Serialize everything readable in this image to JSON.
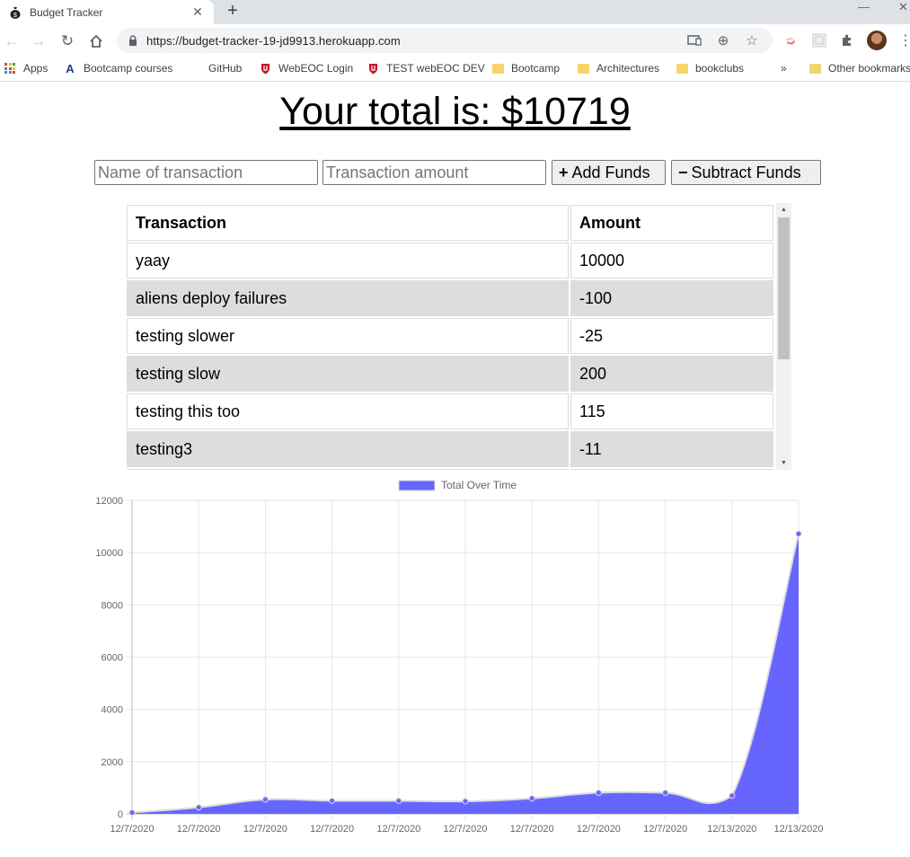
{
  "browser": {
    "tab_title": "Budget Tracker",
    "url": "https://budget-tracker-19-jd9913.herokuapp.com",
    "new_tab_symbol": "+",
    "bookmarks": [
      "Apps",
      "Bootcamp courses",
      "GitHub",
      "WebEOC Login",
      "TEST webEOC DEV",
      "Bootcamp",
      "Architectures",
      "bookclubs"
    ],
    "overflow_symbol": "»",
    "other_bookmarks": "Other bookmarks"
  },
  "page": {
    "title": "Your total is: $10719",
    "name_placeholder": "Name of transaction",
    "amount_placeholder": "Transaction amount",
    "add_label": "Add Funds",
    "subtract_label": "Subtract Funds",
    "add_icon": "+",
    "subtract_icon": "−"
  },
  "table": {
    "headers": [
      "Transaction",
      "Amount"
    ],
    "rows": [
      {
        "name": "yaay",
        "amount": "10000"
      },
      {
        "name": "aliens deploy failures",
        "amount": "-100"
      },
      {
        "name": "testing slower",
        "amount": "-25"
      },
      {
        "name": "testing slow",
        "amount": "200"
      },
      {
        "name": "testing this too",
        "amount": "115"
      },
      {
        "name": "testing3",
        "amount": "-11"
      }
    ]
  },
  "chart_data": {
    "type": "area",
    "legend": {
      "label": "Total Over Time",
      "position": "top"
    },
    "x": [
      "12/7/2020",
      "12/7/2020",
      "12/7/2020",
      "12/7/2020",
      "12/7/2020",
      "12/7/2020",
      "12/7/2020",
      "12/7/2020",
      "12/7/2020",
      "12/13/2020",
      "12/13/2020"
    ],
    "series": [
      {
        "name": "Total Over Time",
        "values": [
          50,
          250,
          550,
          500,
          500,
          480,
          595,
          810,
          810,
          695,
          10719
        ]
      }
    ],
    "yticks": [
      0,
      2000,
      4000,
      6000,
      8000,
      10000,
      12000
    ],
    "ylim": [
      0,
      12000
    ],
    "grid": true,
    "colors": {
      "fill": "#6666ff",
      "line": "#dcdcdc",
      "point": "#6666ff"
    }
  }
}
